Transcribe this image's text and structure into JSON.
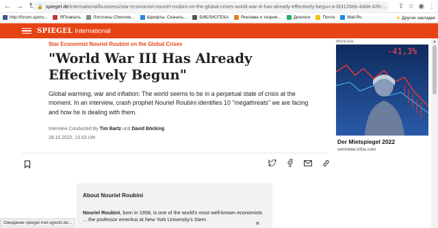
{
  "browser": {
    "url_domain": "spiegel.de",
    "url_path": "/international/business/star-economist-nouriel-roubini-on-the-global-crises-world-war-iii-has-already-effectively-begun-a-fd3126eb-4dd4-42fc-..."
  },
  "bookmarks": {
    "items": [
      {
        "label": "http://forum.sporu...",
        "color": "#3b5998"
      },
      {
        "label": "ЯПлакалъ",
        "color": "#c0392b"
      },
      {
        "label": "Логотипы Chevrole...",
        "color": "#7f8c8d"
      },
      {
        "label": "Шрифты. Скачать...",
        "color": "#2e86de"
      },
      {
        "label": "БИБЛИОТЕКА",
        "color": "#555555"
      },
      {
        "label": "Реклама и теория...",
        "color": "#e67e22"
      },
      {
        "label": "Диалоги",
        "color": "#27ae60"
      },
      {
        "label": "Почта",
        "color": "#f1c40f"
      },
      {
        "label": "Mail.Ru",
        "color": "#168de2"
      }
    ],
    "other": "Другие закладки"
  },
  "header": {
    "logo": "SPIEGEL",
    "section": "International",
    "brand_color": "#e64415"
  },
  "article": {
    "kicker": "Star Economist Nouriel Roubini on the Global Crises",
    "headline": "\"World War III Has Already Effectively Begun\"",
    "lede": "Global warming, war and inflation: The world seems to be in a perpetual state of crisis at the moment. In an interview, crash prophet Nouriel Roubini identifies 10 \"megathreats\" we are facing and how he is dealing with them.",
    "byline_prefix": "Interview Conducted By",
    "author1": "Tim Bartz",
    "byline_and": "und",
    "author2": "David Böcking",
    "date": "28.10.2022, 13.53 Uhr"
  },
  "about": {
    "title": "About Nouriel Roubini",
    "name": "Nouriel Roubini",
    "text": ", born in 1958, is one of the world's most well-known economists ... the professor emeritus at New York University's Stern"
  },
  "ad": {
    "label": "ANZEIGE",
    "percent": "-41,3%",
    "title": "Der Mietspiegel 2022",
    "source": "vermieter.infos.com"
  },
  "status": {
    "text": "Ожидание spiegel.met.vgwort.de..."
  }
}
